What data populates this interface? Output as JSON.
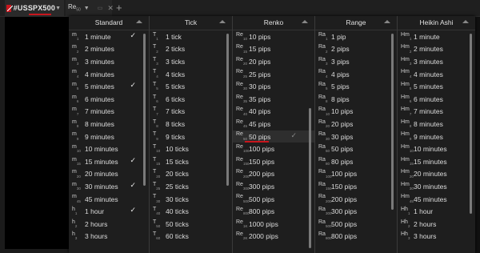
{
  "toolbar": {
    "tab1": {
      "symbol": "#USSPX500",
      "arrow": "▼"
    },
    "tab2": {
      "type_letters": "Re",
      "type_sub": "50",
      "arrow": "▼",
      "dim": "▭",
      "close": "✕"
    },
    "add_tab": "+"
  },
  "accent_color": "#c8161d",
  "columns": [
    {
      "header": "Standard",
      "items": [
        {
          "p": "m",
          "s": "1",
          "label": "1 minute",
          "checked": true
        },
        {
          "p": "m",
          "s": "2",
          "label": "2 minutes",
          "checked": false
        },
        {
          "p": "m",
          "s": "3",
          "label": "3 minutes",
          "checked": false
        },
        {
          "p": "m",
          "s": "4",
          "label": "4 minutes",
          "checked": false
        },
        {
          "p": "m",
          "s": "5",
          "label": "5 minutes",
          "checked": true
        },
        {
          "p": "m",
          "s": "6",
          "label": "6 minutes",
          "checked": false
        },
        {
          "p": "m",
          "s": "7",
          "label": "7 minutes",
          "checked": false
        },
        {
          "p": "m",
          "s": "8",
          "label": "8 minutes",
          "checked": false
        },
        {
          "p": "m",
          "s": "9",
          "label": "9 minutes",
          "checked": false
        },
        {
          "p": "m",
          "s": "10",
          "label": "10 minutes",
          "checked": false
        },
        {
          "p": "m",
          "s": "15",
          "label": "15 minutes",
          "checked": true
        },
        {
          "p": "m",
          "s": "20",
          "label": "20 minutes",
          "checked": false
        },
        {
          "p": "m",
          "s": "30",
          "label": "30 minutes",
          "checked": true
        },
        {
          "p": "m",
          "s": "45",
          "label": "45 minutes",
          "checked": false
        },
        {
          "p": "h",
          "s": "1",
          "label": "1 hour",
          "checked": true
        },
        {
          "p": "h",
          "s": "2",
          "label": "2 hours",
          "checked": false
        },
        {
          "p": "h",
          "s": "3",
          "label": "3 hours",
          "checked": false
        }
      ]
    },
    {
      "header": "Tick",
      "items": [
        {
          "p": "T",
          "s": "1",
          "label": "1 tick"
        },
        {
          "p": "T",
          "s": "2",
          "label": "2 ticks"
        },
        {
          "p": "T",
          "s": "3",
          "label": "3 ticks"
        },
        {
          "p": "T",
          "s": "4",
          "label": "4 ticks"
        },
        {
          "p": "T",
          "s": "5",
          "label": "5 ticks"
        },
        {
          "p": "T",
          "s": "6",
          "label": "6 ticks"
        },
        {
          "p": "T",
          "s": "7",
          "label": "7 ticks"
        },
        {
          "p": "T",
          "s": "8",
          "label": "8 ticks"
        },
        {
          "p": "T",
          "s": "9",
          "label": "9 ticks"
        },
        {
          "p": "T",
          "s": "10",
          "label": "10 ticks"
        },
        {
          "p": "T",
          "s": "15",
          "label": "15 ticks"
        },
        {
          "p": "T",
          "s": "20",
          "label": "20 ticks"
        },
        {
          "p": "T",
          "s": "25",
          "label": "25 ticks"
        },
        {
          "p": "T",
          "s": "30",
          "label": "30 ticks"
        },
        {
          "p": "T",
          "s": "40",
          "label": "40 ticks"
        },
        {
          "p": "T",
          "s": "50",
          "label": "50 ticks"
        },
        {
          "p": "T",
          "s": "60",
          "label": "60 ticks"
        }
      ]
    },
    {
      "header": "Renko",
      "items": [
        {
          "p": "Re",
          "s": "10",
          "label": "10 pips"
        },
        {
          "p": "Re",
          "s": "15",
          "label": "15 pips"
        },
        {
          "p": "Re",
          "s": "20",
          "label": "20 pips"
        },
        {
          "p": "Re",
          "s": "25",
          "label": "25 pips"
        },
        {
          "p": "Re",
          "s": "30",
          "label": "30 pips"
        },
        {
          "p": "Re",
          "s": "35",
          "label": "35 pips"
        },
        {
          "p": "Re",
          "s": "40",
          "label": "40 pips"
        },
        {
          "p": "Re",
          "s": "45",
          "label": "45 pips"
        },
        {
          "p": "Re",
          "s": "50",
          "label": "50 pips",
          "checked": true,
          "selected": true
        },
        {
          "p": "Re",
          "s": "100",
          "label": "100 pips"
        },
        {
          "p": "Re",
          "s": "150",
          "label": "150 pips"
        },
        {
          "p": "Re",
          "s": "200",
          "label": "200 pips"
        },
        {
          "p": "Re",
          "s": "300",
          "label": "300 pips"
        },
        {
          "p": "Re",
          "s": "500",
          "label": "500 pips"
        },
        {
          "p": "Re",
          "s": "800",
          "label": "800 pips"
        },
        {
          "p": "Re",
          "s": "1K",
          "label": "1000 pips"
        },
        {
          "p": "Re",
          "s": "2K",
          "label": "2000 pips"
        }
      ]
    },
    {
      "header": "Range",
      "items": [
        {
          "p": "Ra",
          "s": "1",
          "label": "1 pip"
        },
        {
          "p": "Ra",
          "s": "2",
          "label": "2 pips"
        },
        {
          "p": "Ra",
          "s": "3",
          "label": "3 pips"
        },
        {
          "p": "Ra",
          "s": "4",
          "label": "4 pips"
        },
        {
          "p": "Ra",
          "s": "5",
          "label": "5 pips"
        },
        {
          "p": "Ra",
          "s": "8",
          "label": "8 pips"
        },
        {
          "p": "Ra",
          "s": "10",
          "label": "10 pips"
        },
        {
          "p": "Ra",
          "s": "20",
          "label": "20 pips"
        },
        {
          "p": "Ra",
          "s": "30",
          "label": "30 pips"
        },
        {
          "p": "Ra",
          "s": "50",
          "label": "50 pips"
        },
        {
          "p": "Ra",
          "s": "80",
          "label": "80 pips"
        },
        {
          "p": "Ra",
          "s": "100",
          "label": "100 pips"
        },
        {
          "p": "Ra",
          "s": "150",
          "label": "150 pips"
        },
        {
          "p": "Ra",
          "s": "200",
          "label": "200 pips"
        },
        {
          "p": "Ra",
          "s": "300",
          "label": "300 pips"
        },
        {
          "p": "Ra",
          "s": "500",
          "label": "500 pips"
        },
        {
          "p": "Ra",
          "s": "800",
          "label": "800 pips"
        }
      ]
    },
    {
      "header": "Heikin Ashi",
      "items": [
        {
          "p": "Hm",
          "s": "1",
          "label": "1 minute"
        },
        {
          "p": "Hm",
          "s": "2",
          "label": "2 minutes"
        },
        {
          "p": "Hm",
          "s": "3",
          "label": "3 minutes"
        },
        {
          "p": "Hm",
          "s": "4",
          "label": "4 minutes"
        },
        {
          "p": "Hm",
          "s": "5",
          "label": "5 minutes"
        },
        {
          "p": "Hm",
          "s": "6",
          "label": "6 minutes"
        },
        {
          "p": "Hm",
          "s": "7",
          "label": "7 minutes"
        },
        {
          "p": "Hm",
          "s": "8",
          "label": "8 minutes"
        },
        {
          "p": "Hm",
          "s": "9",
          "label": "9 minutes"
        },
        {
          "p": "Hm",
          "s": "10",
          "label": "10 minutes"
        },
        {
          "p": "Hm",
          "s": "15",
          "label": "15 minutes"
        },
        {
          "p": "Hm",
          "s": "20",
          "label": "20 minutes"
        },
        {
          "p": "Hm",
          "s": "30",
          "label": "30 minutes"
        },
        {
          "p": "Hm",
          "s": "45",
          "label": "45 minutes"
        },
        {
          "p": "Hh",
          "s": "1",
          "label": "1 hour"
        },
        {
          "p": "Hh",
          "s": "2",
          "label": "2 hours"
        },
        {
          "p": "Hh",
          "s": "3",
          "label": "3 hours"
        }
      ]
    }
  ]
}
